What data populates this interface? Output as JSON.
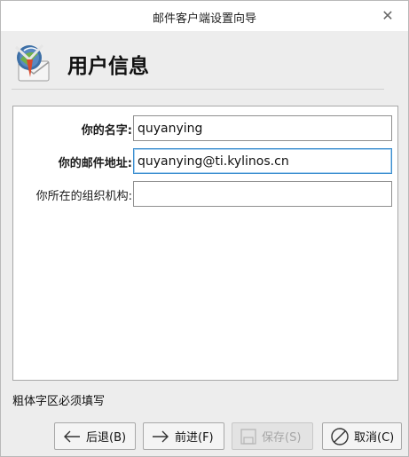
{
  "window": {
    "title": "邮件客户端设置向导",
    "close_glyph": "✕"
  },
  "header": {
    "title": "用户信息",
    "icon": "mail-client-icon"
  },
  "form": {
    "name_label": "你的名字:",
    "name_value": "quyanying",
    "email_label": "你的邮件地址:",
    "email_value": "quyanying@ti.kylinos.cn",
    "org_label": "你所在的组织机构:",
    "org_value": ""
  },
  "hint": "粗体字区必须填写",
  "buttons": {
    "back": "后退(B)",
    "next": "前进(F)",
    "save": "保存(S)",
    "cancel": "取消(C)"
  },
  "colors": {
    "accent_focus": "#3c8ecf",
    "disabled_text": "#a6a6a6"
  }
}
